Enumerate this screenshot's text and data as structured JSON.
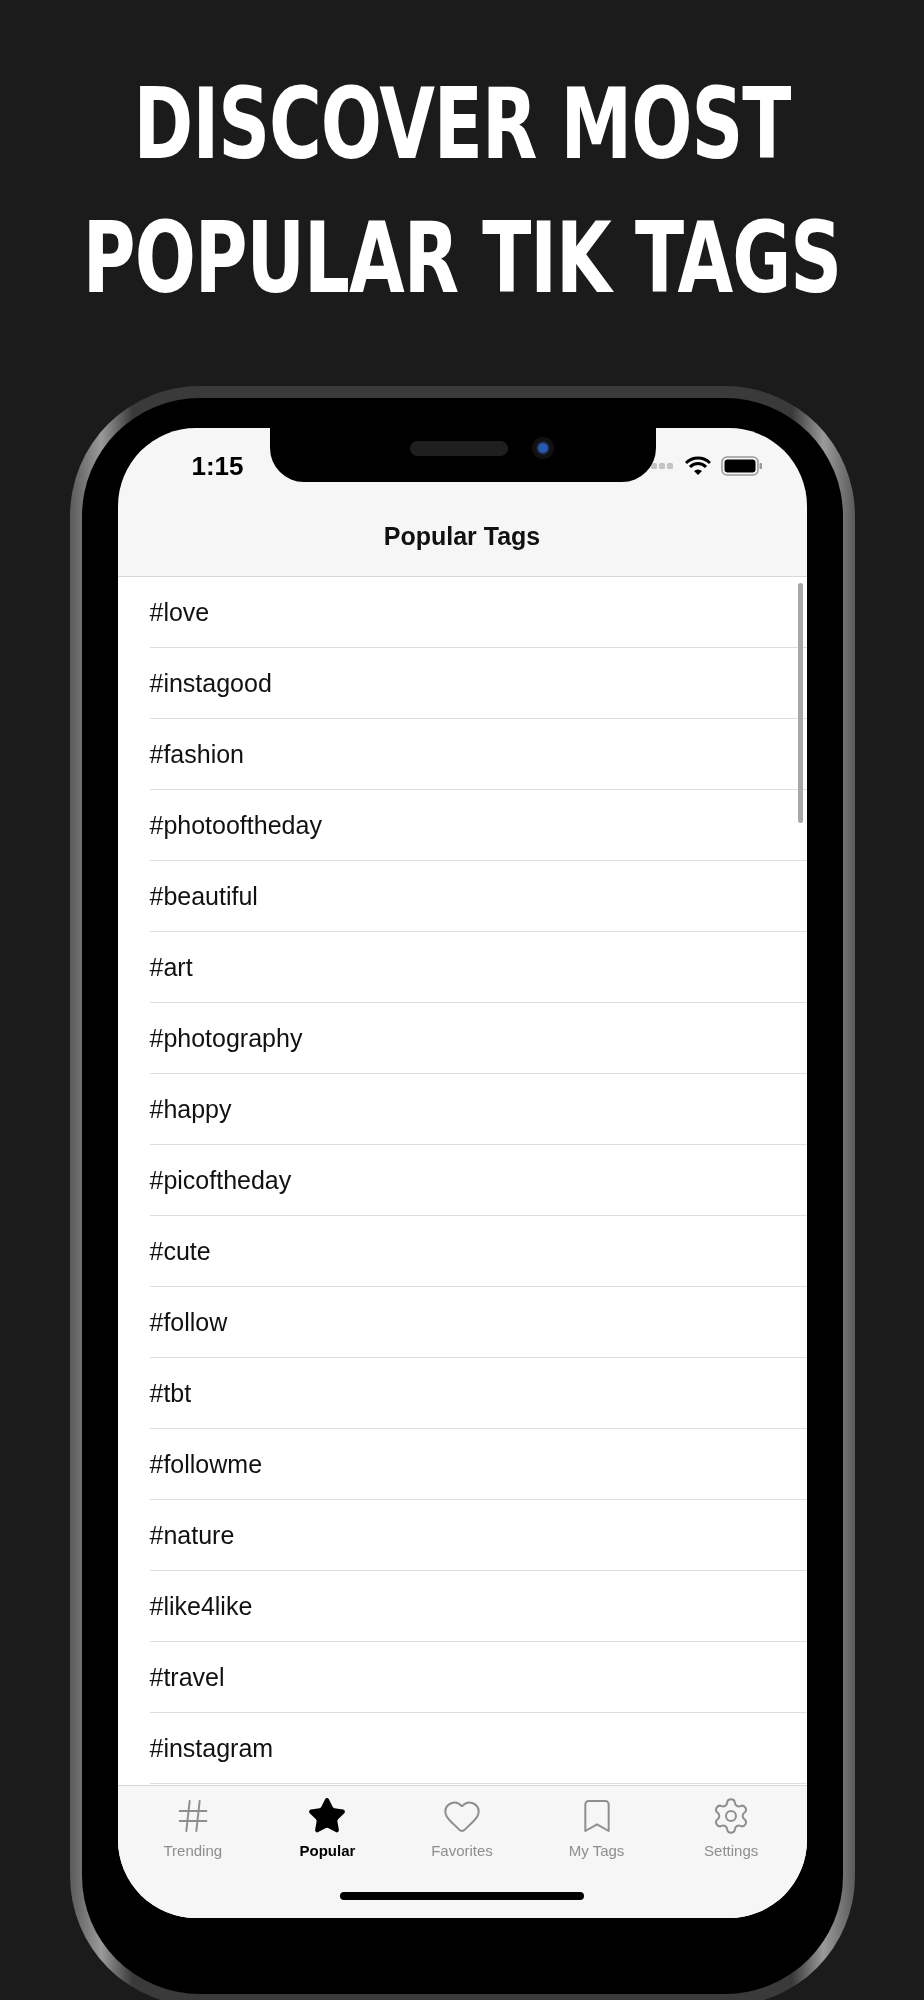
{
  "headline": [
    "DISCOVER MOST",
    "POPULAR TIK TAGS"
  ],
  "status_bar": {
    "time": "1:15"
  },
  "nav_bar": {
    "title": "Popular Tags"
  },
  "tags": [
    "#love",
    "#instagood",
    "#fashion",
    "#photooftheday",
    "#beautiful",
    "#art",
    "#photography",
    "#happy",
    "#picoftheday",
    "#cute",
    "#follow",
    "#tbt",
    "#followme",
    "#nature",
    "#like4like",
    "#travel",
    "#instagram"
  ],
  "tab_bar": [
    {
      "label": "Trending",
      "selected": false
    },
    {
      "label": "Popular",
      "selected": true
    },
    {
      "label": "Favorites",
      "selected": false
    },
    {
      "label": "My Tags",
      "selected": false
    },
    {
      "label": "Settings",
      "selected": false
    }
  ]
}
